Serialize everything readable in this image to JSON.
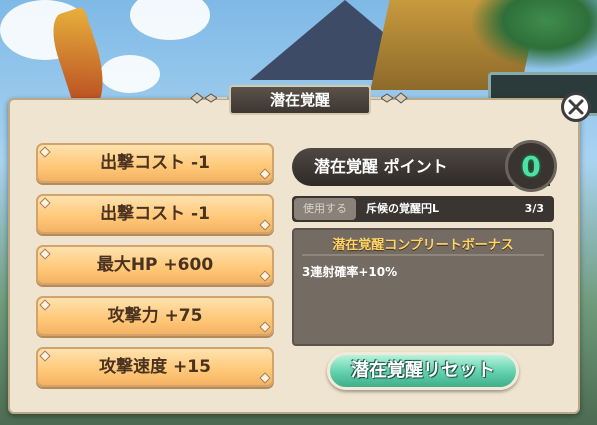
{
  "panel": {
    "title": "潜在覚醒"
  },
  "skills": [
    "出撃コスト -1",
    "出撃コスト -1",
    "最大HP +600",
    "攻撃力 +75",
    "攻撃速度 +15"
  ],
  "points": {
    "label": "潜在覚醒 ポイント",
    "value": "0"
  },
  "use_item": {
    "button_label": "使用する",
    "item_name": "斥候の覚醒円L",
    "count": "3/3"
  },
  "bonus": {
    "heading": "潜在覚醒コンプリートボーナス",
    "text": "3連射確率+10%"
  },
  "reset_button": "潜在覚醒リセット",
  "icons": {
    "close": "close-icon",
    "title_ornament": "ornament-icon"
  },
  "colors": {
    "points_accent": "#4fe0a8",
    "bonus_heading": "#ffd56a",
    "reset_button": "#66d3b0"
  }
}
